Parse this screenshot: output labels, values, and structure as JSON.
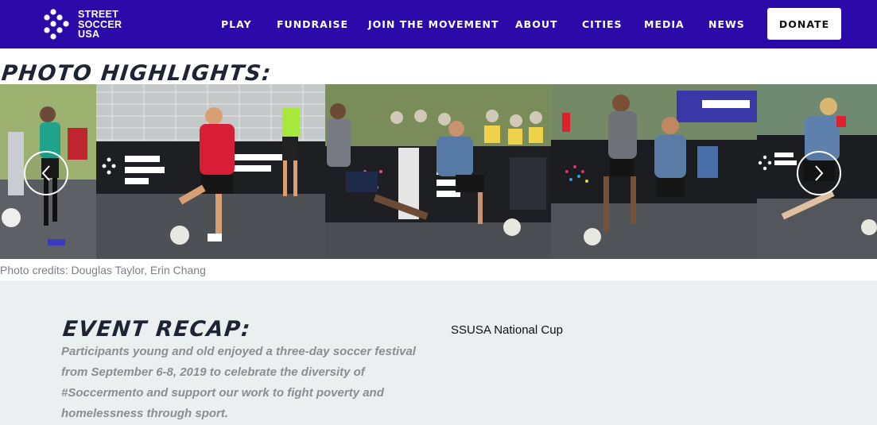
{
  "brand": {
    "line1": "STREET",
    "line2": "SOCCER",
    "line3": "USA"
  },
  "nav": {
    "items": [
      "PLAY",
      "FUNDRAISE",
      "JOIN THE MOVEMENT",
      "ABOUT",
      "CITIES",
      "MEDIA",
      "NEWS"
    ],
    "donate_label": "DONATE"
  },
  "photos": {
    "title": "PHOTO HIGHLIGHTS:",
    "credits": "Photo credits: Douglas Taylor, Erin Chang",
    "prev_icon": "chevron-left-icon",
    "next_icon": "chevron-right-icon"
  },
  "recap": {
    "title": "EVENT RECAP:",
    "text": "Participants young and old enjoyed a three-day soccer festival from September 6-8, 2019 to celebrate the diversity of #Soccermento and support our work to fight poverty and homelessness through sport.",
    "side_label": "SSUSA National Cup"
  },
  "colors": {
    "nav_bg": "#2a0aa8",
    "title": "#1e2433",
    "recap_bg": "#eceff0",
    "muted_text": "#8a8e94"
  }
}
